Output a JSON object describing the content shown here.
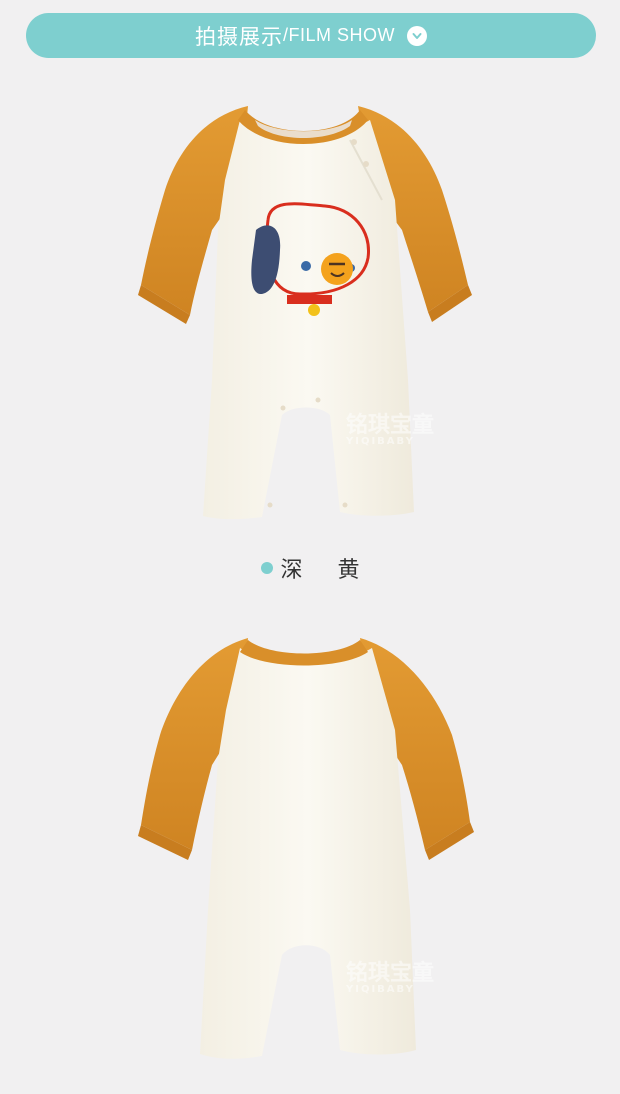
{
  "banner": {
    "title_cn": "拍摄展示",
    "separator": "/",
    "title_en": "FILM SHOW",
    "icon": "chevron-down-icon"
  },
  "colors": {
    "accent": "#7ecfcf",
    "sleeve": "#d98f2a",
    "body": "#f8f5ea"
  },
  "variant": {
    "color_name": "深 黄"
  },
  "watermark": {
    "brand_cn": "铭琪宝童",
    "brand_en": "YIQIBABY"
  }
}
